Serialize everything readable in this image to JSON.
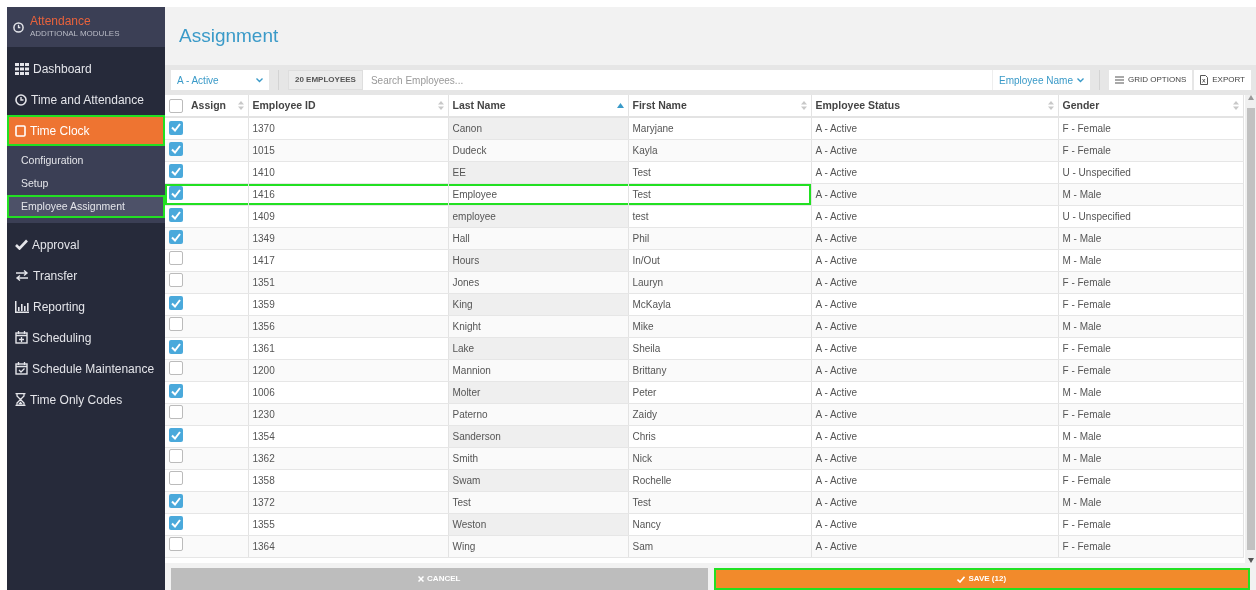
{
  "sidebar": {
    "header": {
      "title": "Attendance",
      "subtitle": "ADDITIONAL MODULES"
    },
    "items": [
      {
        "label": "Dashboard",
        "selected": false,
        "highlighted": false
      },
      {
        "label": "Time and Attendance",
        "selected": false,
        "highlighted": false
      },
      {
        "label": "Time Clock",
        "selected": true,
        "highlighted": true,
        "children": [
          {
            "label": "Configuration",
            "selected": false,
            "highlighted": false
          },
          {
            "label": "Setup",
            "selected": false,
            "highlighted": false
          },
          {
            "label": "Employee Assignment",
            "selected": true,
            "highlighted": true
          }
        ]
      },
      {
        "label": "Approval",
        "selected": false,
        "highlighted": false
      },
      {
        "label": "Transfer",
        "selected": false,
        "highlighted": false
      },
      {
        "label": "Reporting",
        "selected": false,
        "highlighted": false
      },
      {
        "label": "Scheduling",
        "selected": false,
        "highlighted": false
      },
      {
        "label": "Schedule Maintenance",
        "selected": false,
        "highlighted": false
      },
      {
        "label": "Time Only Codes",
        "selected": false,
        "highlighted": false
      }
    ]
  },
  "page": {
    "title": "Assignment"
  },
  "toolbar": {
    "status_filter": {
      "value": "A - Active"
    },
    "employee_count": "20 EMPLOYEES",
    "search": {
      "placeholder": "Search Employees..."
    },
    "search_by": {
      "value": "Employee Name"
    },
    "buttons": [
      "GRID OPTIONS",
      "EXPORT"
    ]
  },
  "table": {
    "select_all": {
      "checked": false
    },
    "assign_column": {
      "label": "Assign",
      "sorted": false
    },
    "columns": [
      {
        "label": "Employee ID",
        "sorted": false
      },
      {
        "label": "Last Name",
        "sorted": true
      },
      {
        "label": "First Name",
        "sorted": false
      },
      {
        "label": "Employee Status",
        "sorted": false
      },
      {
        "label": "Gender",
        "sorted": false
      }
    ],
    "rows": [
      {
        "assigned": true,
        "highlighted": false,
        "cells": [
          "1370",
          "Canon",
          "Maryjane",
          "A - Active",
          "F - Female"
        ]
      },
      {
        "assigned": true,
        "highlighted": false,
        "cells": [
          "1015",
          "Dudeck",
          "Kayla",
          "A - Active",
          "F - Female"
        ]
      },
      {
        "assigned": true,
        "highlighted": false,
        "cells": [
          "1410",
          "EE",
          "Test",
          "A - Active",
          "U - Unspecified"
        ]
      },
      {
        "assigned": true,
        "highlighted": true,
        "cells": [
          "1416",
          "Employee",
          "Test",
          "A - Active",
          "M - Male"
        ]
      },
      {
        "assigned": true,
        "highlighted": false,
        "cells": [
          "1409",
          "employee",
          "test",
          "A - Active",
          "U - Unspecified"
        ]
      },
      {
        "assigned": true,
        "highlighted": false,
        "cells": [
          "1349",
          "Hall",
          "Phil",
          "A - Active",
          "M - Male"
        ]
      },
      {
        "assigned": false,
        "highlighted": false,
        "cells": [
          "1417",
          "Hours",
          "In/Out",
          "A - Active",
          "M - Male"
        ]
      },
      {
        "assigned": false,
        "highlighted": false,
        "cells": [
          "1351",
          "Jones",
          "Lauryn",
          "A - Active",
          "F - Female"
        ]
      },
      {
        "assigned": true,
        "highlighted": false,
        "cells": [
          "1359",
          "King",
          "McKayla",
          "A - Active",
          "F - Female"
        ]
      },
      {
        "assigned": false,
        "highlighted": false,
        "cells": [
          "1356",
          "Knight",
          "Mike",
          "A - Active",
          "M - Male"
        ]
      },
      {
        "assigned": true,
        "highlighted": false,
        "cells": [
          "1361",
          "Lake",
          "Sheila",
          "A - Active",
          "F - Female"
        ]
      },
      {
        "assigned": false,
        "highlighted": false,
        "cells": [
          "1200",
          "Mannion",
          "Brittany",
          "A - Active",
          "F - Female"
        ]
      },
      {
        "assigned": true,
        "highlighted": false,
        "cells": [
          "1006",
          "Molter",
          "Peter",
          "A - Active",
          "M - Male"
        ]
      },
      {
        "assigned": false,
        "highlighted": false,
        "cells": [
          "1230",
          "Paterno",
          "Zaidy",
          "A - Active",
          "F - Female"
        ]
      },
      {
        "assigned": true,
        "highlighted": false,
        "cells": [
          "1354",
          "Sanderson",
          "Chris",
          "A - Active",
          "M - Male"
        ]
      },
      {
        "assigned": false,
        "highlighted": false,
        "cells": [
          "1362",
          "Smith",
          "Nick",
          "A - Active",
          "M - Male"
        ]
      },
      {
        "assigned": false,
        "highlighted": false,
        "cells": [
          "1358",
          "Swam",
          "Rochelle",
          "A - Active",
          "F - Female"
        ]
      },
      {
        "assigned": true,
        "highlighted": false,
        "cells": [
          "1372",
          "Test",
          "Test",
          "A - Active",
          "M - Male"
        ]
      },
      {
        "assigned": true,
        "highlighted": false,
        "cells": [
          "1355",
          "Weston",
          "Nancy",
          "A - Active",
          "F - Female"
        ]
      },
      {
        "assigned": false,
        "highlighted": false,
        "cells": [
          "1364",
          "Wing",
          "Sam",
          "A - Active",
          "F - Female"
        ]
      }
    ]
  },
  "footer": {
    "cancel": {
      "label": "CANCEL",
      "highlighted": false
    },
    "save": {
      "label": "SAVE (12)",
      "highlighted": true
    }
  }
}
